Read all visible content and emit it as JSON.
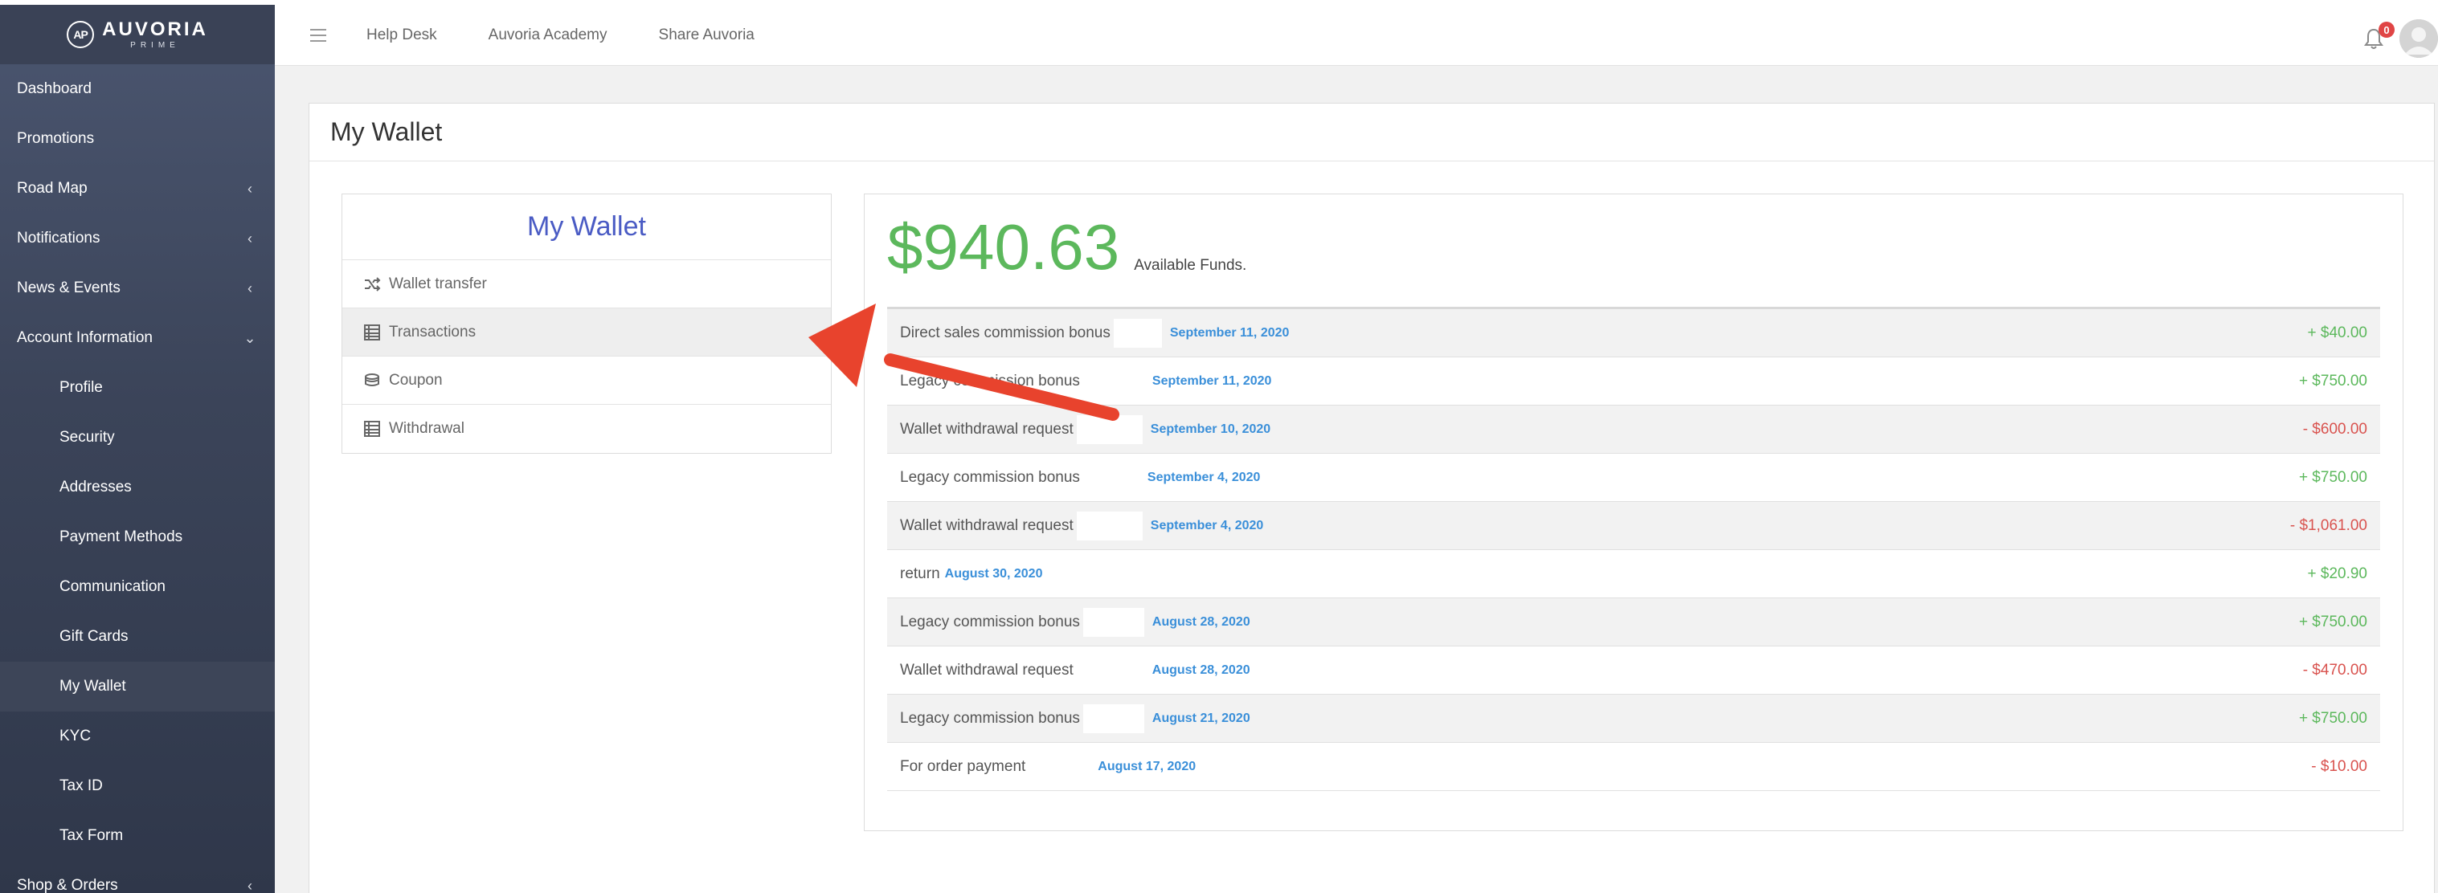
{
  "brand": {
    "name": "AUVORIA",
    "tagline": "PRIME",
    "mark": "AP"
  },
  "sidebar": {
    "items": [
      {
        "label": "Dashboard",
        "chev": "",
        "sub": false
      },
      {
        "label": "Promotions",
        "chev": "",
        "sub": false
      },
      {
        "label": "Road Map",
        "chev": "‹",
        "sub": false
      },
      {
        "label": "Notifications",
        "chev": "‹",
        "sub": false
      },
      {
        "label": "News & Events",
        "chev": "‹",
        "sub": false
      },
      {
        "label": "Account Information",
        "chev": "⌄",
        "sub": false
      },
      {
        "label": "Profile",
        "chev": "",
        "sub": true
      },
      {
        "label": "Security",
        "chev": "",
        "sub": true
      },
      {
        "label": "Addresses",
        "chev": "",
        "sub": true
      },
      {
        "label": "Payment Methods",
        "chev": "",
        "sub": true
      },
      {
        "label": "Communication",
        "chev": "",
        "sub": true
      },
      {
        "label": "Gift Cards",
        "chev": "",
        "sub": true
      },
      {
        "label": "My Wallet",
        "chev": "",
        "sub": true,
        "active": true
      },
      {
        "label": "KYC",
        "chev": "",
        "sub": true
      },
      {
        "label": "Tax ID",
        "chev": "",
        "sub": true
      },
      {
        "label": "Tax Form",
        "chev": "",
        "sub": true
      },
      {
        "label": "Shop & Orders",
        "chev": "‹",
        "sub": false
      }
    ]
  },
  "topbar": {
    "links": [
      "Help Desk",
      "Auvoria Academy",
      "Share Auvoria"
    ],
    "notification_count": "0"
  },
  "page": {
    "title": "My Wallet"
  },
  "wallet_menu": {
    "title": "My Wallet",
    "items": [
      {
        "label": "Wallet transfer",
        "icon": "shuffle-icon"
      },
      {
        "label": "Transactions",
        "icon": "list-icon",
        "active": true
      },
      {
        "label": "Coupon",
        "icon": "coins-icon"
      },
      {
        "label": "Withdrawal",
        "icon": "list-icon"
      }
    ]
  },
  "balance": {
    "amount": "$940.63",
    "label": "Available Funds."
  },
  "transactions": [
    {
      "desc": "Direct sales commission bonus",
      "date": "September 11, 2020",
      "amount": "+ $40.00",
      "type": "pos",
      "redact": 60
    },
    {
      "desc": "Legacy commission bonus",
      "date": "September 11, 2020",
      "amount": "+ $750.00",
      "type": "pos",
      "redact": 76
    },
    {
      "desc": "Wallet withdrawal request",
      "date": "September 10, 2020",
      "amount": "- $600.00",
      "type": "neg",
      "redact": 82
    },
    {
      "desc": "Legacy commission bonus",
      "date": "September 4, 2020",
      "amount": "+ $750.00",
      "type": "pos",
      "redact": 70
    },
    {
      "desc": "Wallet withdrawal request",
      "date": "September 4, 2020",
      "amount": "- $1,061.00",
      "type": "neg",
      "redact": 82
    },
    {
      "desc": "return",
      "date": "August 30, 2020",
      "amount": "+ $20.90",
      "type": "pos",
      "redact": 0
    },
    {
      "desc": "Legacy commission bonus",
      "date": "August 28, 2020",
      "amount": "+ $750.00",
      "type": "pos",
      "redact": 76
    },
    {
      "desc": "Wallet withdrawal request",
      "date": "August 28, 2020",
      "amount": "- $470.00",
      "type": "neg",
      "redact": 84
    },
    {
      "desc": "Legacy commission bonus",
      "date": "August 21, 2020",
      "amount": "+ $750.00",
      "type": "pos",
      "redact": 76
    },
    {
      "desc": "For order payment",
      "date": "August 17, 2020",
      "amount": "- $10.00",
      "type": "neg",
      "redact": 76
    }
  ],
  "colors": {
    "accent": "#4a5bc4",
    "positive": "#5cb85c",
    "negative": "#d9534f",
    "date": "#3a8fd9",
    "annotation_arrow": "#e8432d"
  }
}
